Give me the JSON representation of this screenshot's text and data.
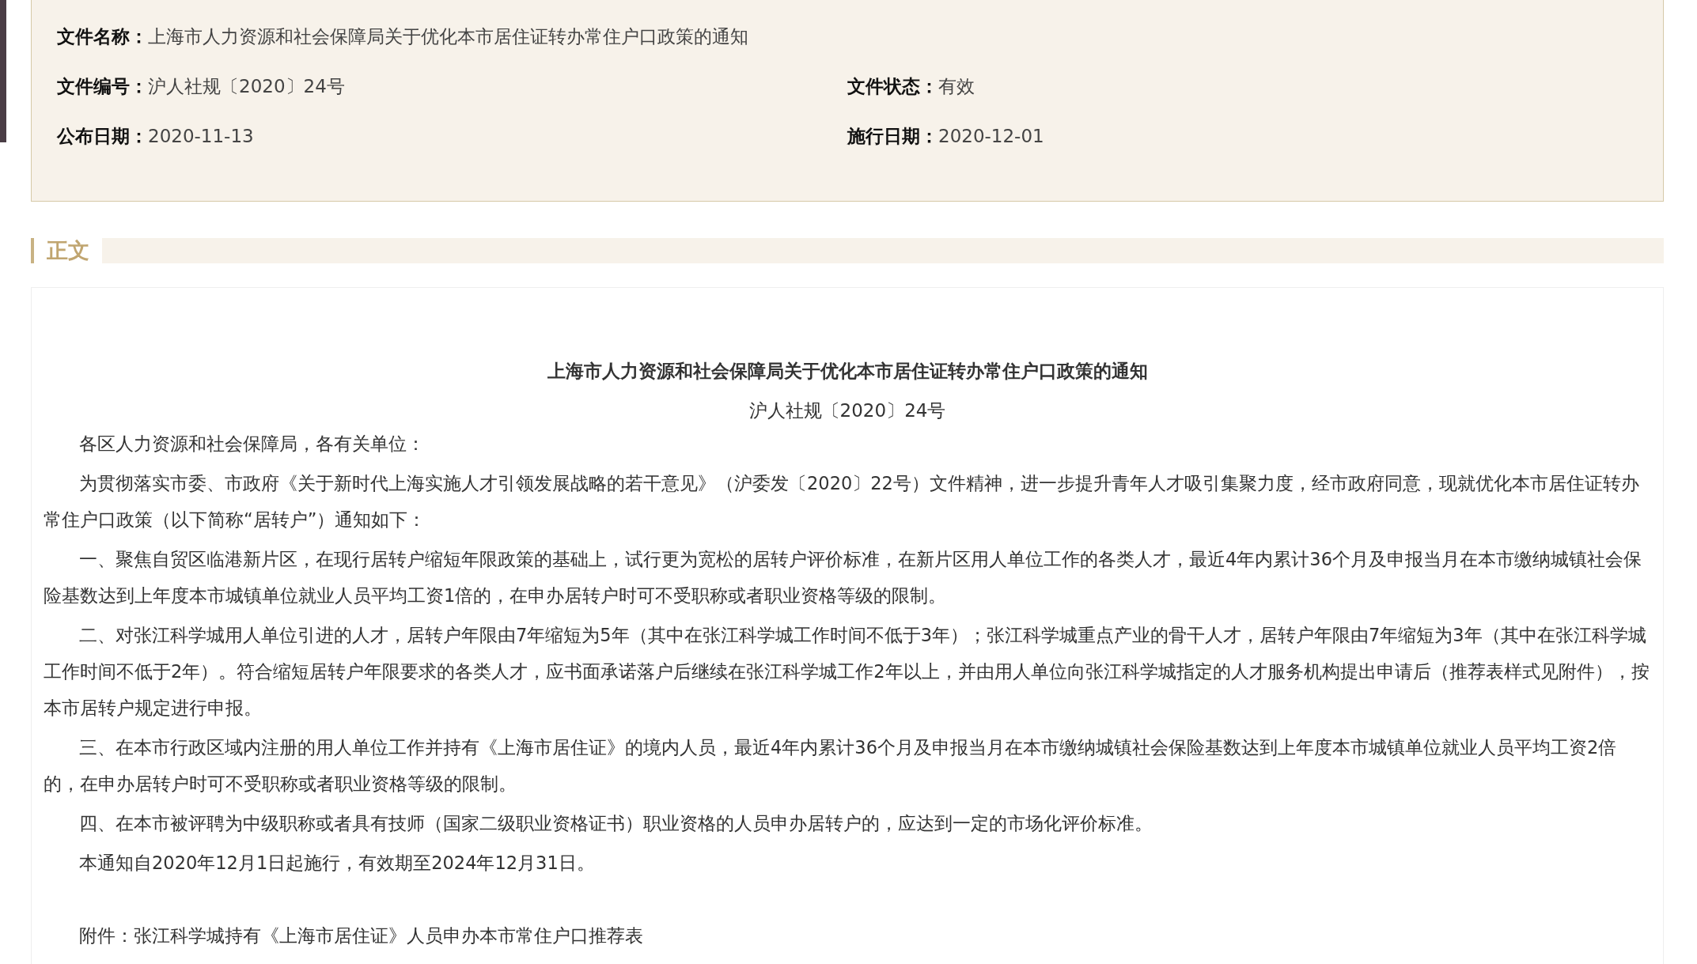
{
  "info": {
    "rows": [
      [
        {
          "label": "文件名称：",
          "value": "上海市人力资源和社会保障局关于优化本市居住证转办常住户口政策的通知"
        }
      ],
      [
        {
          "label": "文件编号：",
          "value": "沪人社规〔2020〕24号"
        },
        {
          "label": "文件状态：",
          "value": "有效"
        }
      ],
      [
        {
          "label": "公布日期：",
          "value": "2020-11-13"
        },
        {
          "label": "施行日期：",
          "value": "2020-12-01"
        }
      ]
    ]
  },
  "section": {
    "title": "正文"
  },
  "document": {
    "title": "上海市人力资源和社会保障局关于优化本市居住证转办常住户口政策的通知",
    "number": "沪人社规〔2020〕24号",
    "paragraphs": [
      "各区人力资源和社会保障局，各有关单位：",
      "为贯彻落实市委、市政府《关于新时代上海实施人才引领发展战略的若干意见》（沪委发〔2020〕22号）文件精神，进一步提升青年人才吸引集聚力度，经市政府同意，现就优化本市居住证转办常住户口政策（以下简称“居转户”）通知如下：",
      "一、聚焦自贸区临港新片区，在现行居转户缩短年限政策的基础上，试行更为宽松的居转户评价标准，在新片区用人单位工作的各类人才，最近4年内累计36个月及申报当月在本市缴纳城镇社会保险基数达到上年度本市城镇单位就业人员平均工资1倍的，在申办居转户时可不受职称或者职业资格等级的限制。",
      "二、对张江科学城用人单位引进的人才，居转户年限由7年缩短为5年（其中在张江科学城工作时间不低于3年）；张江科学城重点产业的骨干人才，居转户年限由7年缩短为3年（其中在张江科学城工作时间不低于2年）。符合缩短居转户年限要求的各类人才，应书面承诺落户后继续在张江科学城工作2年以上，并由用人单位向张江科学城指定的人才服务机构提出申请后（推荐表样式见附件），按本市居转户规定进行申报。",
      "三、在本市行政区域内注册的用人单位工作并持有《上海市居住证》的境内人员，最近4年内累计36个月及申报当月在本市缴纳城镇社会保险基数达到上年度本市城镇单位就业人员平均工资2倍的，在申办居转户时可不受职称或者职业资格等级的限制。",
      "四、在本市被评聘为中级职称或者具有技师（国家二级职业资格证书）职业资格的人员申办居转户的，应达到一定的市场化评价标准。",
      "本通知自2020年12月1日起施行，有效期至2024年12月31日。"
    ],
    "attachment": "附件：张江科学城持有《上海市居住证》人员申办本市常住户口推荐表"
  }
}
